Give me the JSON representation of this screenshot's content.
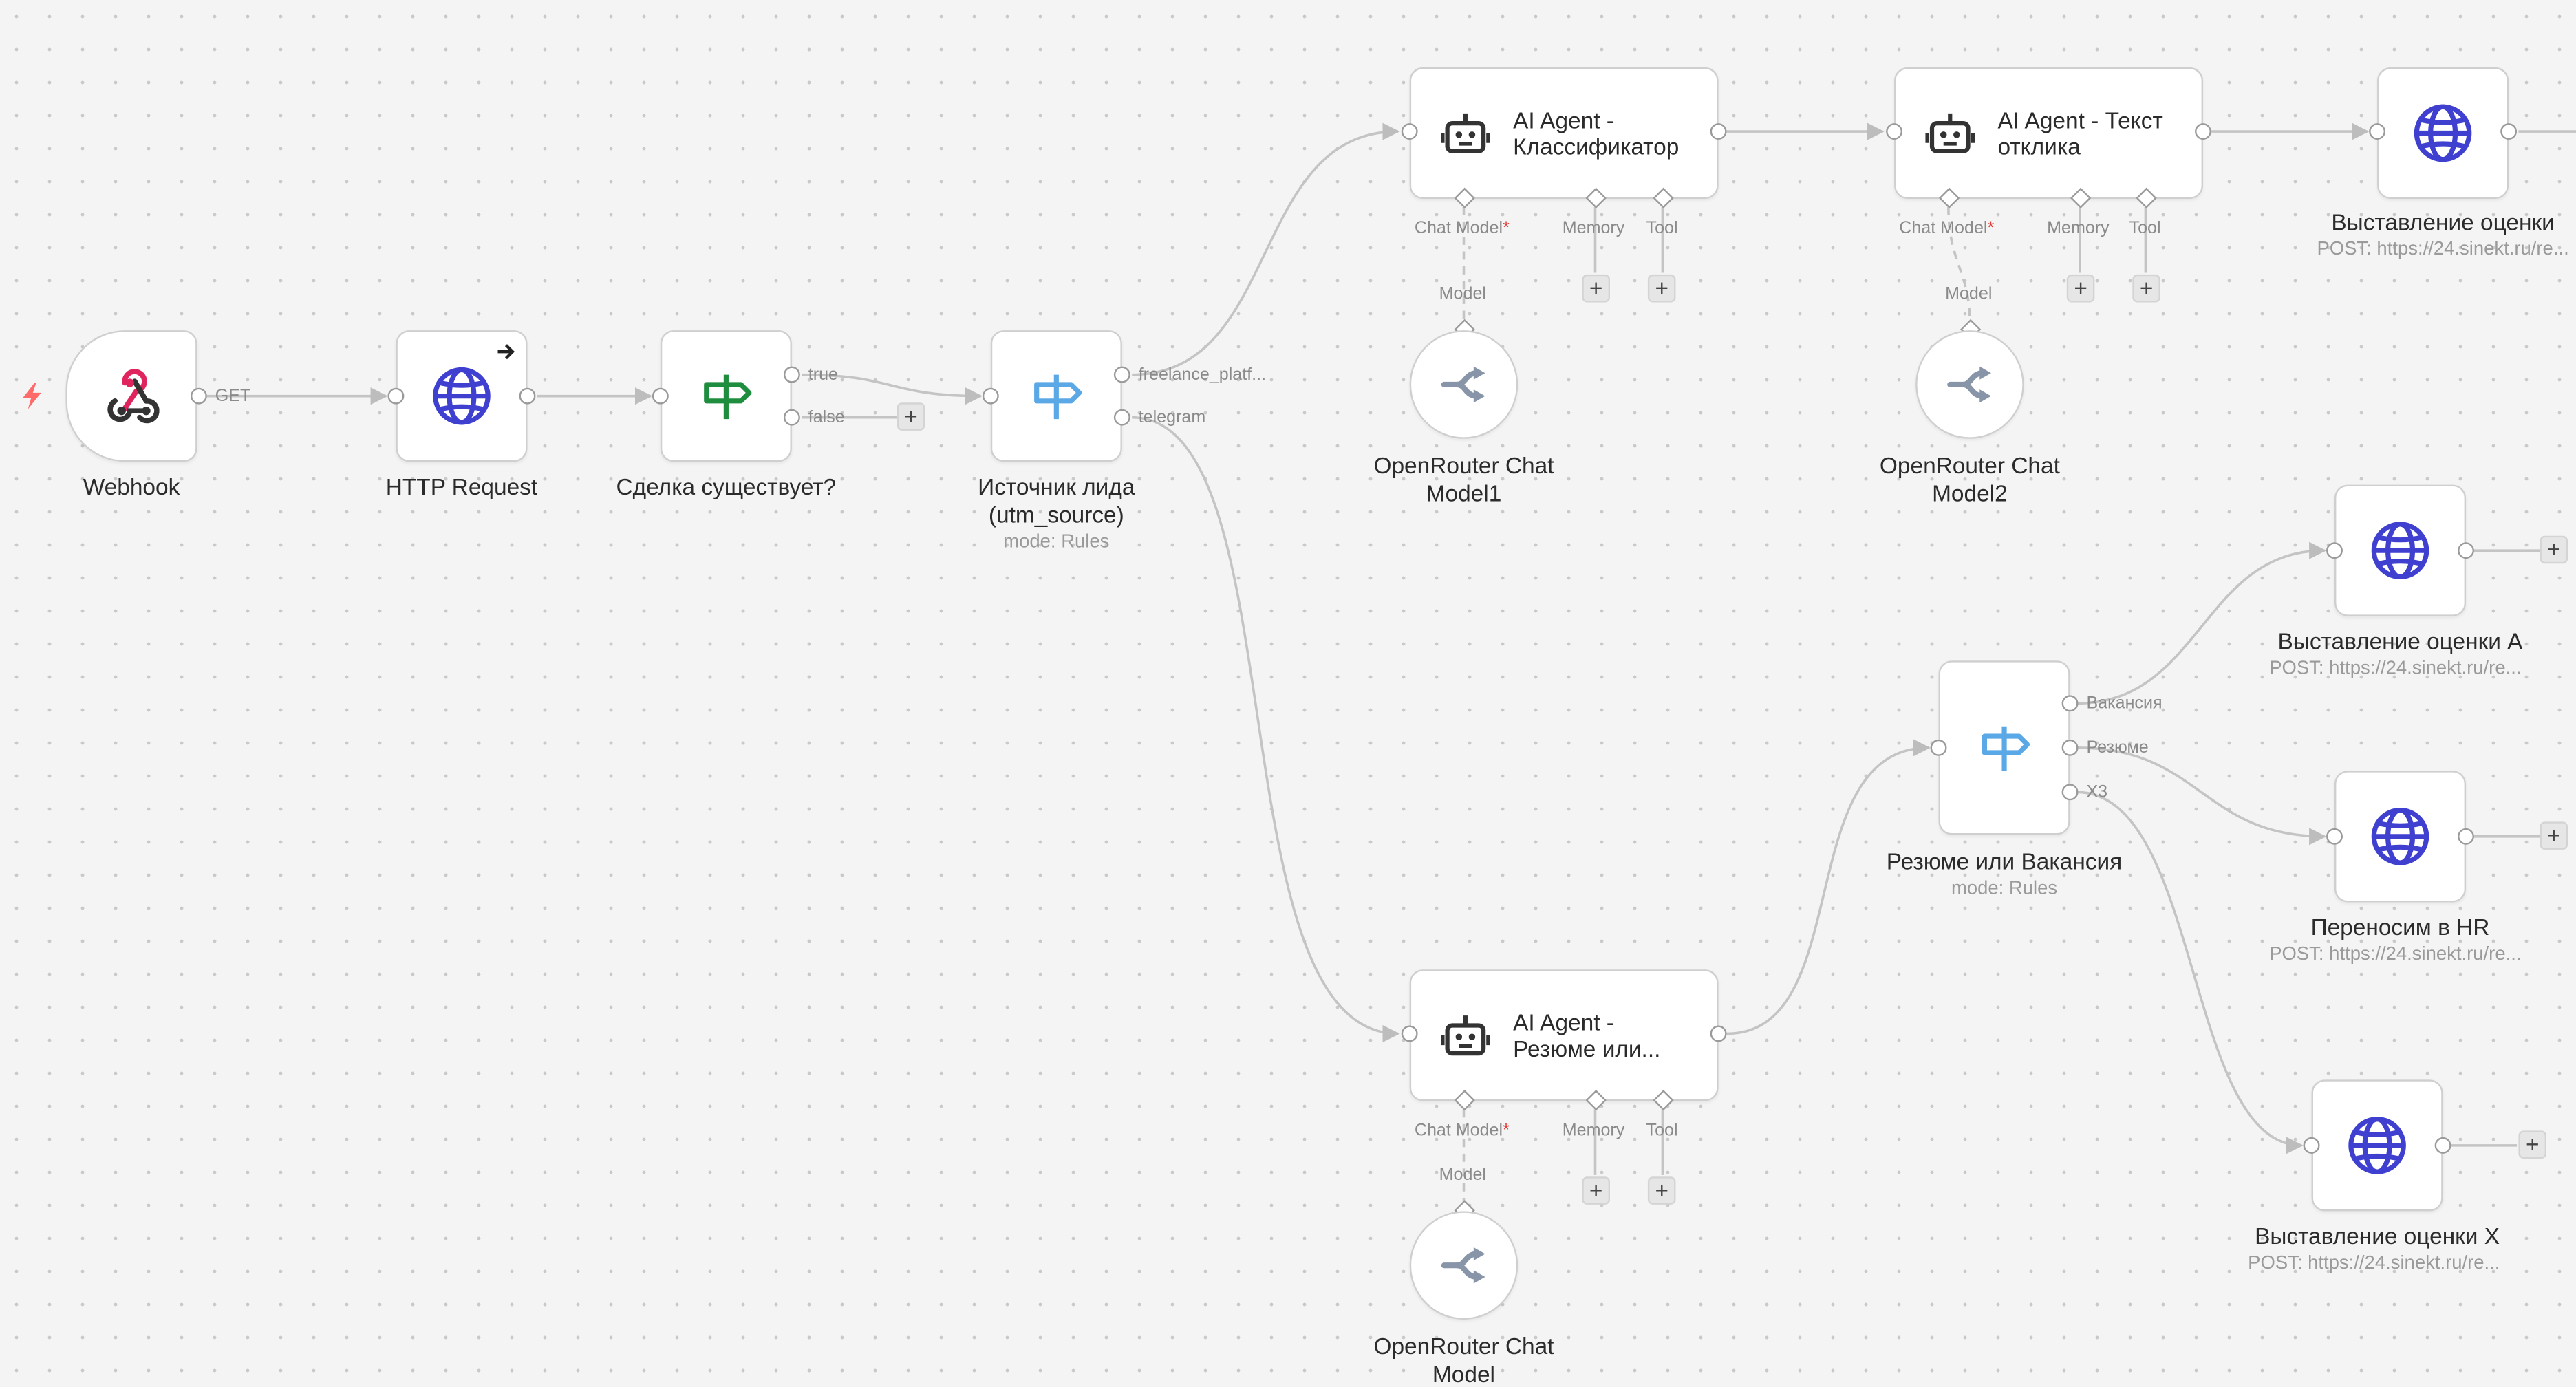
{
  "colors": {
    "canvas_bg": "#f4f4f4",
    "globe_icon": "#3f3fd0",
    "if_icon": "#1e8e3e",
    "switch_icon": "#5aa9e6",
    "webhook_pink": "#e0245e",
    "trigger_bolt": "#ff6b6b",
    "edge": "#c4c4c4"
  },
  "nodes": {
    "webhook": {
      "label": "Webhook",
      "icon": "webhook-icon"
    },
    "http": {
      "label": "HTTP Request",
      "icon": "globe-icon"
    },
    "if": {
      "label": "Сделка существует?",
      "icon": "signpost-icon"
    },
    "source": {
      "label_line1": "Источник лида",
      "label_line2": "(utm_source)",
      "sub": "mode: Rules",
      "icon": "signpost-icon"
    },
    "agent1": {
      "line1": "AI Agent -",
      "line2": "Классификатор",
      "icon": "robot-icon"
    },
    "agent2": {
      "line1": "AI Agent - Текст",
      "line2": "отклика",
      "icon": "robot-icon"
    },
    "agent3": {
      "line1": "AI Agent -",
      "line2": "Резюме или...",
      "icon": "robot-icon"
    },
    "model1": {
      "line1": "OpenRouter Chat",
      "line2": "Model1",
      "icon": "openrouter-icon"
    },
    "model2": {
      "line1": "OpenRouter Chat",
      "line2": "Model2",
      "icon": "openrouter-icon"
    },
    "model3": {
      "line1": "OpenRouter Chat",
      "line2": "Model",
      "icon": "openrouter-icon"
    },
    "post_top": {
      "label": "Выставление оценки",
      "sub": "POST: https://24.sinekt.ru/re...",
      "icon": "globe-icon"
    },
    "post_a": {
      "label": "Выставление оценки А",
      "sub": "POST: https://24.sinekt.ru/re...",
      "icon": "globe-icon"
    },
    "post_hr": {
      "label": "Переносим в HR",
      "sub": "POST: https://24.sinekt.ru/re...",
      "icon": "globe-icon"
    },
    "post_x": {
      "label": "Выставление оценки Х",
      "sub": "POST: https://24.sinekt.ru/re...",
      "icon": "globe-icon"
    },
    "rezume": {
      "label": "Резюме или Вакансия",
      "sub": "mode: Rules",
      "icon": "signpost-icon"
    }
  },
  "port_labels": {
    "get": "GET",
    "true": "true",
    "false": "false",
    "freelance": "freelance_platf...",
    "telegram": "telegram",
    "vakansiya": "Вакансия",
    "rezume": "Резюме",
    "x3": "Х3",
    "chat_model": "Chat Model",
    "required_mark": "*",
    "memory": "Memory",
    "tool": "Tool",
    "model": "Model",
    "plus": "+"
  }
}
